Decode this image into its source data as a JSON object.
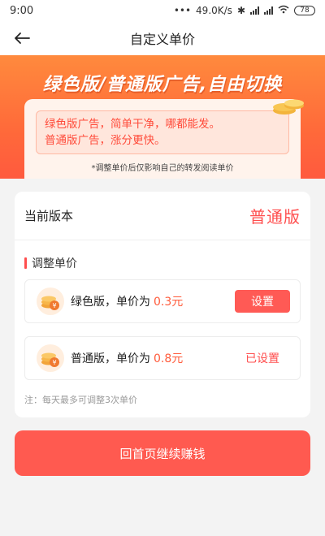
{
  "status_bar": {
    "time": "9:00",
    "net_speed": "49.0K/s",
    "battery": "78"
  },
  "nav": {
    "title": "自定义单价"
  },
  "banner": {
    "headline": "绿色版/普通版广告,自由切换",
    "line1": "绿色版广告，简单干净，哪都能发。",
    "line2": "普通版广告，涨分更快。",
    "note": "*调整单价后仅影响自己的转发阅读单价"
  },
  "current": {
    "label": "当前版本",
    "value": "普通版"
  },
  "adjust": {
    "title": "调整单价",
    "items": [
      {
        "text": "绿色版，单价为",
        "price": "0.3元",
        "action": "设置"
      },
      {
        "text": "普通版，单价为",
        "price": "0.8元",
        "action": "已设置"
      }
    ],
    "tip": "注：每天最多可调整3次单价"
  },
  "cta": {
    "label": "回首页继续赚钱"
  },
  "colors": {
    "accent": "#ff5a50",
    "banner_top": "#ff8a3d",
    "price": "#ff5a3a"
  }
}
